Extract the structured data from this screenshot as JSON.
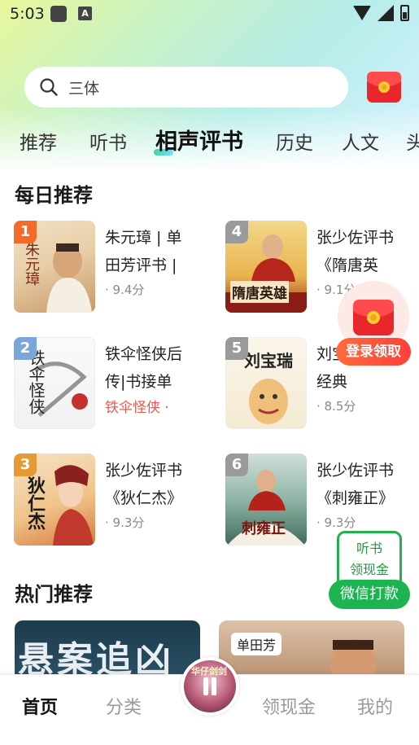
{
  "status_bar": {
    "time": "5:03",
    "app_icon_label": "A"
  },
  "search": {
    "query": "三体"
  },
  "tabs": [
    {
      "label": "推荐"
    },
    {
      "label": "听书"
    },
    {
      "label": "相声评书"
    },
    {
      "label": "历史"
    },
    {
      "label": "人文"
    },
    {
      "label": "头"
    }
  ],
  "daily": {
    "title": "每日推荐",
    "books": [
      {
        "rank": "1",
        "title": "朱元璋 | 单田芳评书 |",
        "meta": "· 9.4分",
        "rank_color": "#f36b2b",
        "cover_text": "朱元璋"
      },
      {
        "rank": "2",
        "title": "铁伞怪侠后传|书接单",
        "meta": "铁伞怪侠 ·",
        "rank_color": "#7aa7d9",
        "cover_text": "铁伞怪侠"
      },
      {
        "rank": "3",
        "title": "张少佐评书《狄仁杰》",
        "meta": "· 9.3分",
        "rank_color": "#e79a33",
        "cover_text": "狄仁杰"
      },
      {
        "rank": "4",
        "title": "张少佐评书《隋唐英",
        "meta": "· 9.1分",
        "rank_color": "#9a9a9a",
        "cover_text": "隋唐英雄"
      },
      {
        "rank": "5",
        "title": "刘宝瑞精选|经典",
        "meta": "· 8.5分",
        "rank_color": "#9a9a9a",
        "cover_text": "刘宝瑞"
      },
      {
        "rank": "6",
        "title": "张少佐评书《刺雍正》",
        "meta": "· 9.3分",
        "rank_color": "#9a9a9a",
        "cover_text": "刺雍正"
      }
    ]
  },
  "float_login": {
    "label": "登录领取"
  },
  "float_wechat": {
    "line1": "听书",
    "line2": "领现金",
    "button": "微信打款"
  },
  "hot": {
    "title": "热门推荐",
    "card1_text": "悬案追凶",
    "card2_tag": "单田芳"
  },
  "player": {
    "disc_text": "华仔剑剑"
  },
  "bottom_nav": [
    {
      "label": "首页"
    },
    {
      "label": "分类"
    },
    {
      "label": "领现金"
    },
    {
      "label": "我的"
    }
  ]
}
